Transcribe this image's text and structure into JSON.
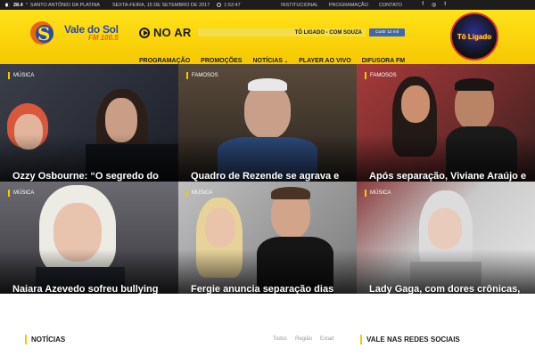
{
  "topbar": {
    "temperature": "28.4",
    "temp_unit": "°",
    "city": "SANTO ANTÔNIO DA PLATINA",
    "date": "SEXTA-FEIRA, 15 DE SETEMBRO DE 2017",
    "time": "1:52:47",
    "links": [
      "INSTITUCIONAL",
      "PROGRAMAÇÃO",
      "CONTATO"
    ],
    "social": [
      "f",
      "◎",
      "t"
    ]
  },
  "header": {
    "logo_line1": "Vale do Sol",
    "logo_line2": "FM 100.5",
    "on_air_label": "NO AR",
    "now_playing": "TÔ LIGADO - COM SOUZA",
    "fb_like": "Curtir 12 mil",
    "badge_text": "Tô Ligado",
    "nav": [
      {
        "label": "PROGRAMAÇÃO"
      },
      {
        "label": "PROMOÇÕES"
      },
      {
        "label": "NOTÍCIAS",
        "dropdown": "⌄"
      },
      {
        "label": "PLAYER AO VIVO"
      },
      {
        "label": "DIFUSORA FM"
      }
    ]
  },
  "tiles": [
    {
      "category": "MÚSICA",
      "title": "Ozzy Osbourne: “O segredo do"
    },
    {
      "category": "FAMOSOS",
      "title": "Quadro de Rezende se agrava e"
    },
    {
      "category": "FAMOSOS",
      "title": "Após separação, Viviane Araújo e"
    },
    {
      "category": "MÚSICA",
      "title": "Naiara Azevedo sofreu bullying"
    },
    {
      "category": "MÚSICA",
      "title": "Fergie anuncia separação dias"
    },
    {
      "category": "MÚSICA",
      "title": "Lady Gaga, com dores crônicas,"
    }
  ],
  "sections": {
    "news_title": "NOTÍCIAS",
    "filters": [
      "Todos",
      "Região",
      "Estad"
    ],
    "social_title": "VALE NAS REDES SOCIAIS"
  },
  "colors": {
    "brand_yellow": "#f6c800",
    "topbar_bg": "#1d1d1d",
    "logo_blue": "#2a4aa8",
    "logo_orange": "#e8650f"
  }
}
